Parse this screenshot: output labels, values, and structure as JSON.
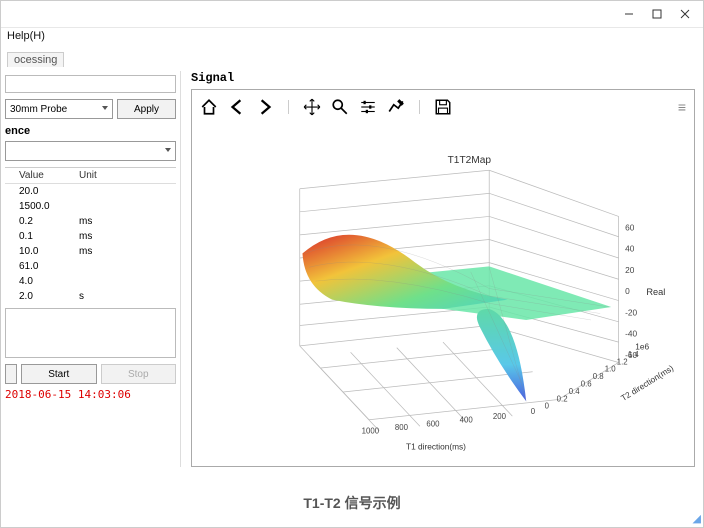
{
  "menu": {
    "help": "Help(H)"
  },
  "tab": {
    "processing": "ocessing"
  },
  "left": {
    "probe": "30mm Probe",
    "apply": "Apply",
    "sequence_title": "ence",
    "headers": {
      "value": "Value",
      "unit": "Unit"
    },
    "rows": [
      {
        "value": "20.0",
        "unit": ""
      },
      {
        "value": "1500.0",
        "unit": ""
      },
      {
        "value": "0.2",
        "unit": "ms"
      },
      {
        "value": "0.1",
        "unit": "ms"
      },
      {
        "value": "10.0",
        "unit": "ms"
      },
      {
        "value": "61.0",
        "unit": ""
      },
      {
        "value": "4.0",
        "unit": ""
      },
      {
        "value": "2.0",
        "unit": "s"
      }
    ],
    "start": "Start",
    "stop": "Stop",
    "timestamp": "2018-06-15 14:03:06"
  },
  "signal": {
    "title": "Signal"
  },
  "chart_data": {
    "type": "surface3d",
    "title": "T1T2Map",
    "x_axis": {
      "label": "T1 direction(ms)",
      "ticks": [
        0,
        200,
        400,
        600,
        800,
        1000
      ]
    },
    "y_axis": {
      "label": "T2 direction(ms)",
      "scale_note": "1e6",
      "ticks": [
        0,
        0.2,
        0.4,
        0.6,
        0.8,
        1.0,
        1.2,
        1.4
      ]
    },
    "z_axis": {
      "label": "Real",
      "ticks": [
        -60,
        -40,
        -20,
        0,
        20,
        40,
        60
      ]
    },
    "value_range": {
      "min": -70,
      "max": 60
    },
    "colormap": "rainbow"
  },
  "caption": "T1-T2 信号示例"
}
